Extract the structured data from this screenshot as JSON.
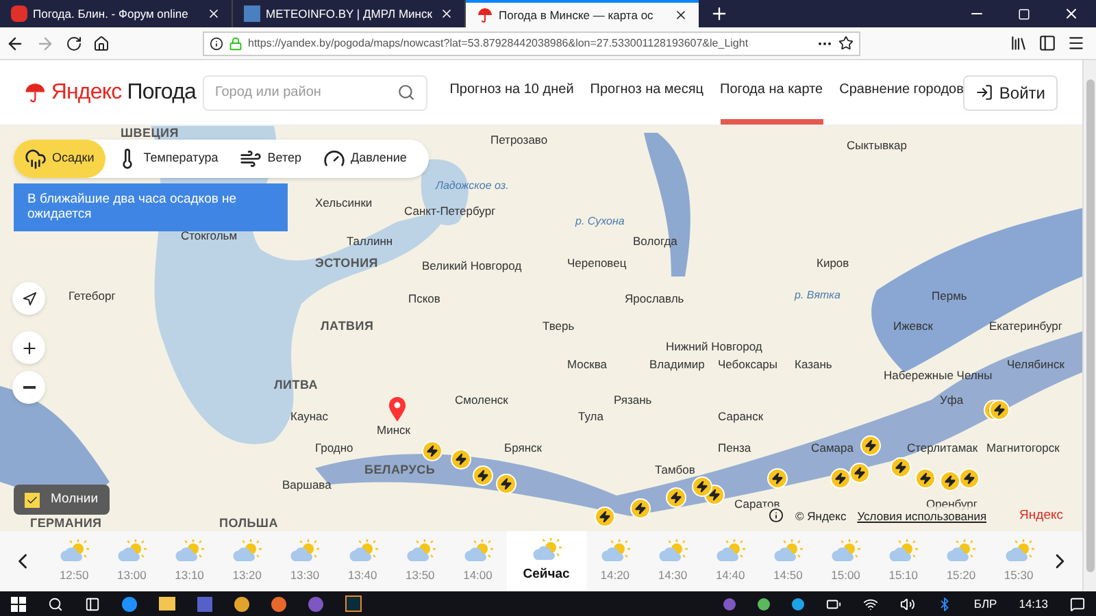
{
  "browser": {
    "tabs": [
      {
        "title": "Погода. Блин. - Форум online",
        "selected": false,
        "kind": "forum"
      },
      {
        "title": "METEOINFO.BY | ДМРЛ Минск",
        "selected": false,
        "kind": "meteo"
      },
      {
        "title": "Погода в Минске — карта ос",
        "selected": true,
        "kind": "yandex"
      }
    ],
    "url": "https://yandex.by/pogoda/maps/nowcast?lat=53.87928442038986&lon=27.533001128193607&le_Light"
  },
  "site": {
    "brand": "Яндекс",
    "product": "Погода",
    "search": {
      "placeholder": "Город или район"
    },
    "nav": [
      {
        "label": "Прогноз на 10 дней",
        "selected": false
      },
      {
        "label": "Прогноз на месяц",
        "selected": false
      },
      {
        "label": "Погода на карте",
        "selected": true
      },
      {
        "label": "Сравнение городов",
        "selected": false
      }
    ],
    "login": "Войти"
  },
  "map": {
    "layers": [
      {
        "label": "Осадки",
        "selected": true,
        "kind": "precip"
      },
      {
        "label": "Температура",
        "selected": false,
        "kind": "temp"
      },
      {
        "label": "Ветер",
        "selected": false,
        "kind": "wind"
      },
      {
        "label": "Давление",
        "selected": false,
        "kind": "pressure"
      }
    ],
    "alert": "В ближайшие два часа осадков не ожидается",
    "lightning": {
      "label": "Молнии",
      "checked": true
    },
    "labels": [
      {
        "text": "ШВЕЦИЯ",
        "kind": "country"
      },
      {
        "text": "Петрозаво",
        "kind": "city"
      },
      {
        "text": "Сыктывкар",
        "kind": "city"
      },
      {
        "text": "Ладожское оз.",
        "kind": "water"
      },
      {
        "text": "Хельсинки",
        "kind": "city"
      },
      {
        "text": "Санкт-Петербург",
        "kind": "city"
      },
      {
        "text": "р. Сухона",
        "kind": "water"
      },
      {
        "text": "Стокгольм",
        "kind": "city"
      },
      {
        "text": "Таллинн",
        "kind": "city"
      },
      {
        "text": "Вологда",
        "kind": "city"
      },
      {
        "text": "ЭСТОНИЯ",
        "kind": "country"
      },
      {
        "text": "Великий Новгород",
        "kind": "city"
      },
      {
        "text": "Череповец",
        "kind": "city"
      },
      {
        "text": "Киров",
        "kind": "city"
      },
      {
        "text": "Гетеборг",
        "kind": "city"
      },
      {
        "text": "Псков",
        "kind": "city"
      },
      {
        "text": "Ярославль",
        "kind": "city"
      },
      {
        "text": "р. Вятка",
        "kind": "water"
      },
      {
        "text": "Пермь",
        "kind": "city"
      },
      {
        "text": "ЛАТВИЯ",
        "kind": "country"
      },
      {
        "text": "Тверь",
        "kind": "city"
      },
      {
        "text": "Ижевск",
        "kind": "city"
      },
      {
        "text": "Екатеринбург",
        "kind": "city"
      },
      {
        "text": "Нижний Новгород",
        "kind": "city"
      },
      {
        "text": "Москва",
        "kind": "city"
      },
      {
        "text": "Владимир",
        "kind": "city"
      },
      {
        "text": "Чебоксары",
        "kind": "city"
      },
      {
        "text": "Казань",
        "kind": "city"
      },
      {
        "text": "Набережные Челны",
        "kind": "city"
      },
      {
        "text": "Челябинск",
        "kind": "city"
      },
      {
        "text": "ЛИТВА",
        "kind": "country"
      },
      {
        "text": "Смоленск",
        "kind": "city"
      },
      {
        "text": "Рязань",
        "kind": "city"
      },
      {
        "text": "Уфа",
        "kind": "city"
      },
      {
        "text": "Каунас",
        "kind": "city"
      },
      {
        "text": "Тула",
        "kind": "city"
      },
      {
        "text": "Саранск",
        "kind": "city"
      },
      {
        "text": "Минск",
        "kind": "city"
      },
      {
        "text": "Гродно",
        "kind": "city"
      },
      {
        "text": "Брянск",
        "kind": "city"
      },
      {
        "text": "Пенза",
        "kind": "city"
      },
      {
        "text": "Самара",
        "kind": "city"
      },
      {
        "text": "Стерлитамак",
        "kind": "city"
      },
      {
        "text": "Магнитогорск",
        "kind": "city"
      },
      {
        "text": "БЕЛАРУСЬ",
        "kind": "country"
      },
      {
        "text": "Тамбов",
        "kind": "city"
      },
      {
        "text": "Варшава",
        "kind": "city"
      },
      {
        "text": "Саратов",
        "kind": "city"
      },
      {
        "text": "Оренбург",
        "kind": "city"
      },
      {
        "text": "ГЕРМАНИЯ",
        "kind": "country"
      },
      {
        "text": "ПОЛЬША",
        "kind": "country"
      }
    ],
    "attribution": {
      "copyright": "© Яндекс",
      "terms": "Условия использования",
      "logo": "Яндекс"
    }
  },
  "timeline": [
    {
      "time": "12:50",
      "selected": false
    },
    {
      "time": "13:00",
      "selected": false
    },
    {
      "time": "13:10",
      "selected": false
    },
    {
      "time": "13:20",
      "selected": false
    },
    {
      "time": "13:30",
      "selected": false
    },
    {
      "time": "13:40",
      "selected": false
    },
    {
      "time": "13:50",
      "selected": false
    },
    {
      "time": "14:00",
      "selected": false
    },
    {
      "time": "Сейчас",
      "selected": true
    },
    {
      "time": "14:20",
      "selected": false
    },
    {
      "time": "14:30",
      "selected": false
    },
    {
      "time": "14:40",
      "selected": false
    },
    {
      "time": "14:50",
      "selected": false
    },
    {
      "time": "15:00",
      "selected": false
    },
    {
      "time": "15:10",
      "selected": false
    },
    {
      "time": "15:20",
      "selected": false
    },
    {
      "time": "15:30",
      "selected": false
    }
  ],
  "taskbar": {
    "language": "БЛР",
    "time": "14:13"
  }
}
